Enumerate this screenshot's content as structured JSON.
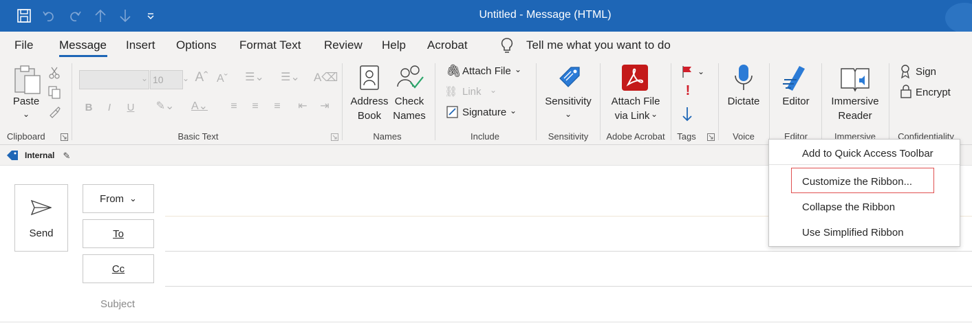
{
  "window": {
    "title": "Untitled  -  Message (HTML)"
  },
  "colors": {
    "titlebar": "#1e66b6",
    "ribbon_bg": "#f3f2f1",
    "pdf_red": "#c41a1a",
    "highlight_border": "#e05050",
    "flag_red": "#d11f2b",
    "arrow_blue": "#1e66b6"
  },
  "quick_access": [
    "save-icon",
    "undo-icon",
    "redo-icon",
    "up-arrow-icon",
    "down-arrow-icon",
    "customize-dropdown-icon"
  ],
  "menu": {
    "tabs": [
      "File",
      "Message",
      "Insert",
      "Options",
      "Format Text",
      "Review",
      "Help",
      "Acrobat"
    ],
    "active_tab": "Message",
    "tell_me": "Tell me what you want to do"
  },
  "ribbon": {
    "clipboard": {
      "label": "Clipboard",
      "paste": "Paste"
    },
    "basic_text": {
      "label": "Basic Text",
      "font_size": "10"
    },
    "names": {
      "label": "Names",
      "address_book_1": "Address",
      "address_book_2": "Book",
      "check_names_1": "Check",
      "check_names_2": "Names"
    },
    "include": {
      "label": "Include",
      "attach_file": "Attach File",
      "link": "Link",
      "signature": "Signature"
    },
    "sensitivity": {
      "label": "Sensitivity",
      "button": "Sensitivity"
    },
    "adobe": {
      "label": "Adobe Acrobat",
      "attach_1": "Attach File",
      "attach_2": "via Link"
    },
    "tags": {
      "label": "Tags"
    },
    "voice": {
      "label": "Voice",
      "dictate": "Dictate"
    },
    "editor": {
      "label": "Editor",
      "editor": "Editor"
    },
    "immersive": {
      "label": "Immersive",
      "reader_1": "Immersive",
      "reader_2": "Reader"
    },
    "confidentiality": {
      "label": "Confidentiality",
      "sign": "Sign",
      "encrypt": "Encrypt"
    }
  },
  "infobar": {
    "label": "Internal"
  },
  "compose": {
    "send": "Send",
    "from": "From",
    "to": "To",
    "cc": "Cc",
    "subject": "Subject"
  },
  "context_menu": {
    "items": [
      "Add to Quick Access Toolbar",
      "Customize the Ribbon...",
      "Collapse the Ribbon",
      "Use Simplified Ribbon"
    ]
  }
}
